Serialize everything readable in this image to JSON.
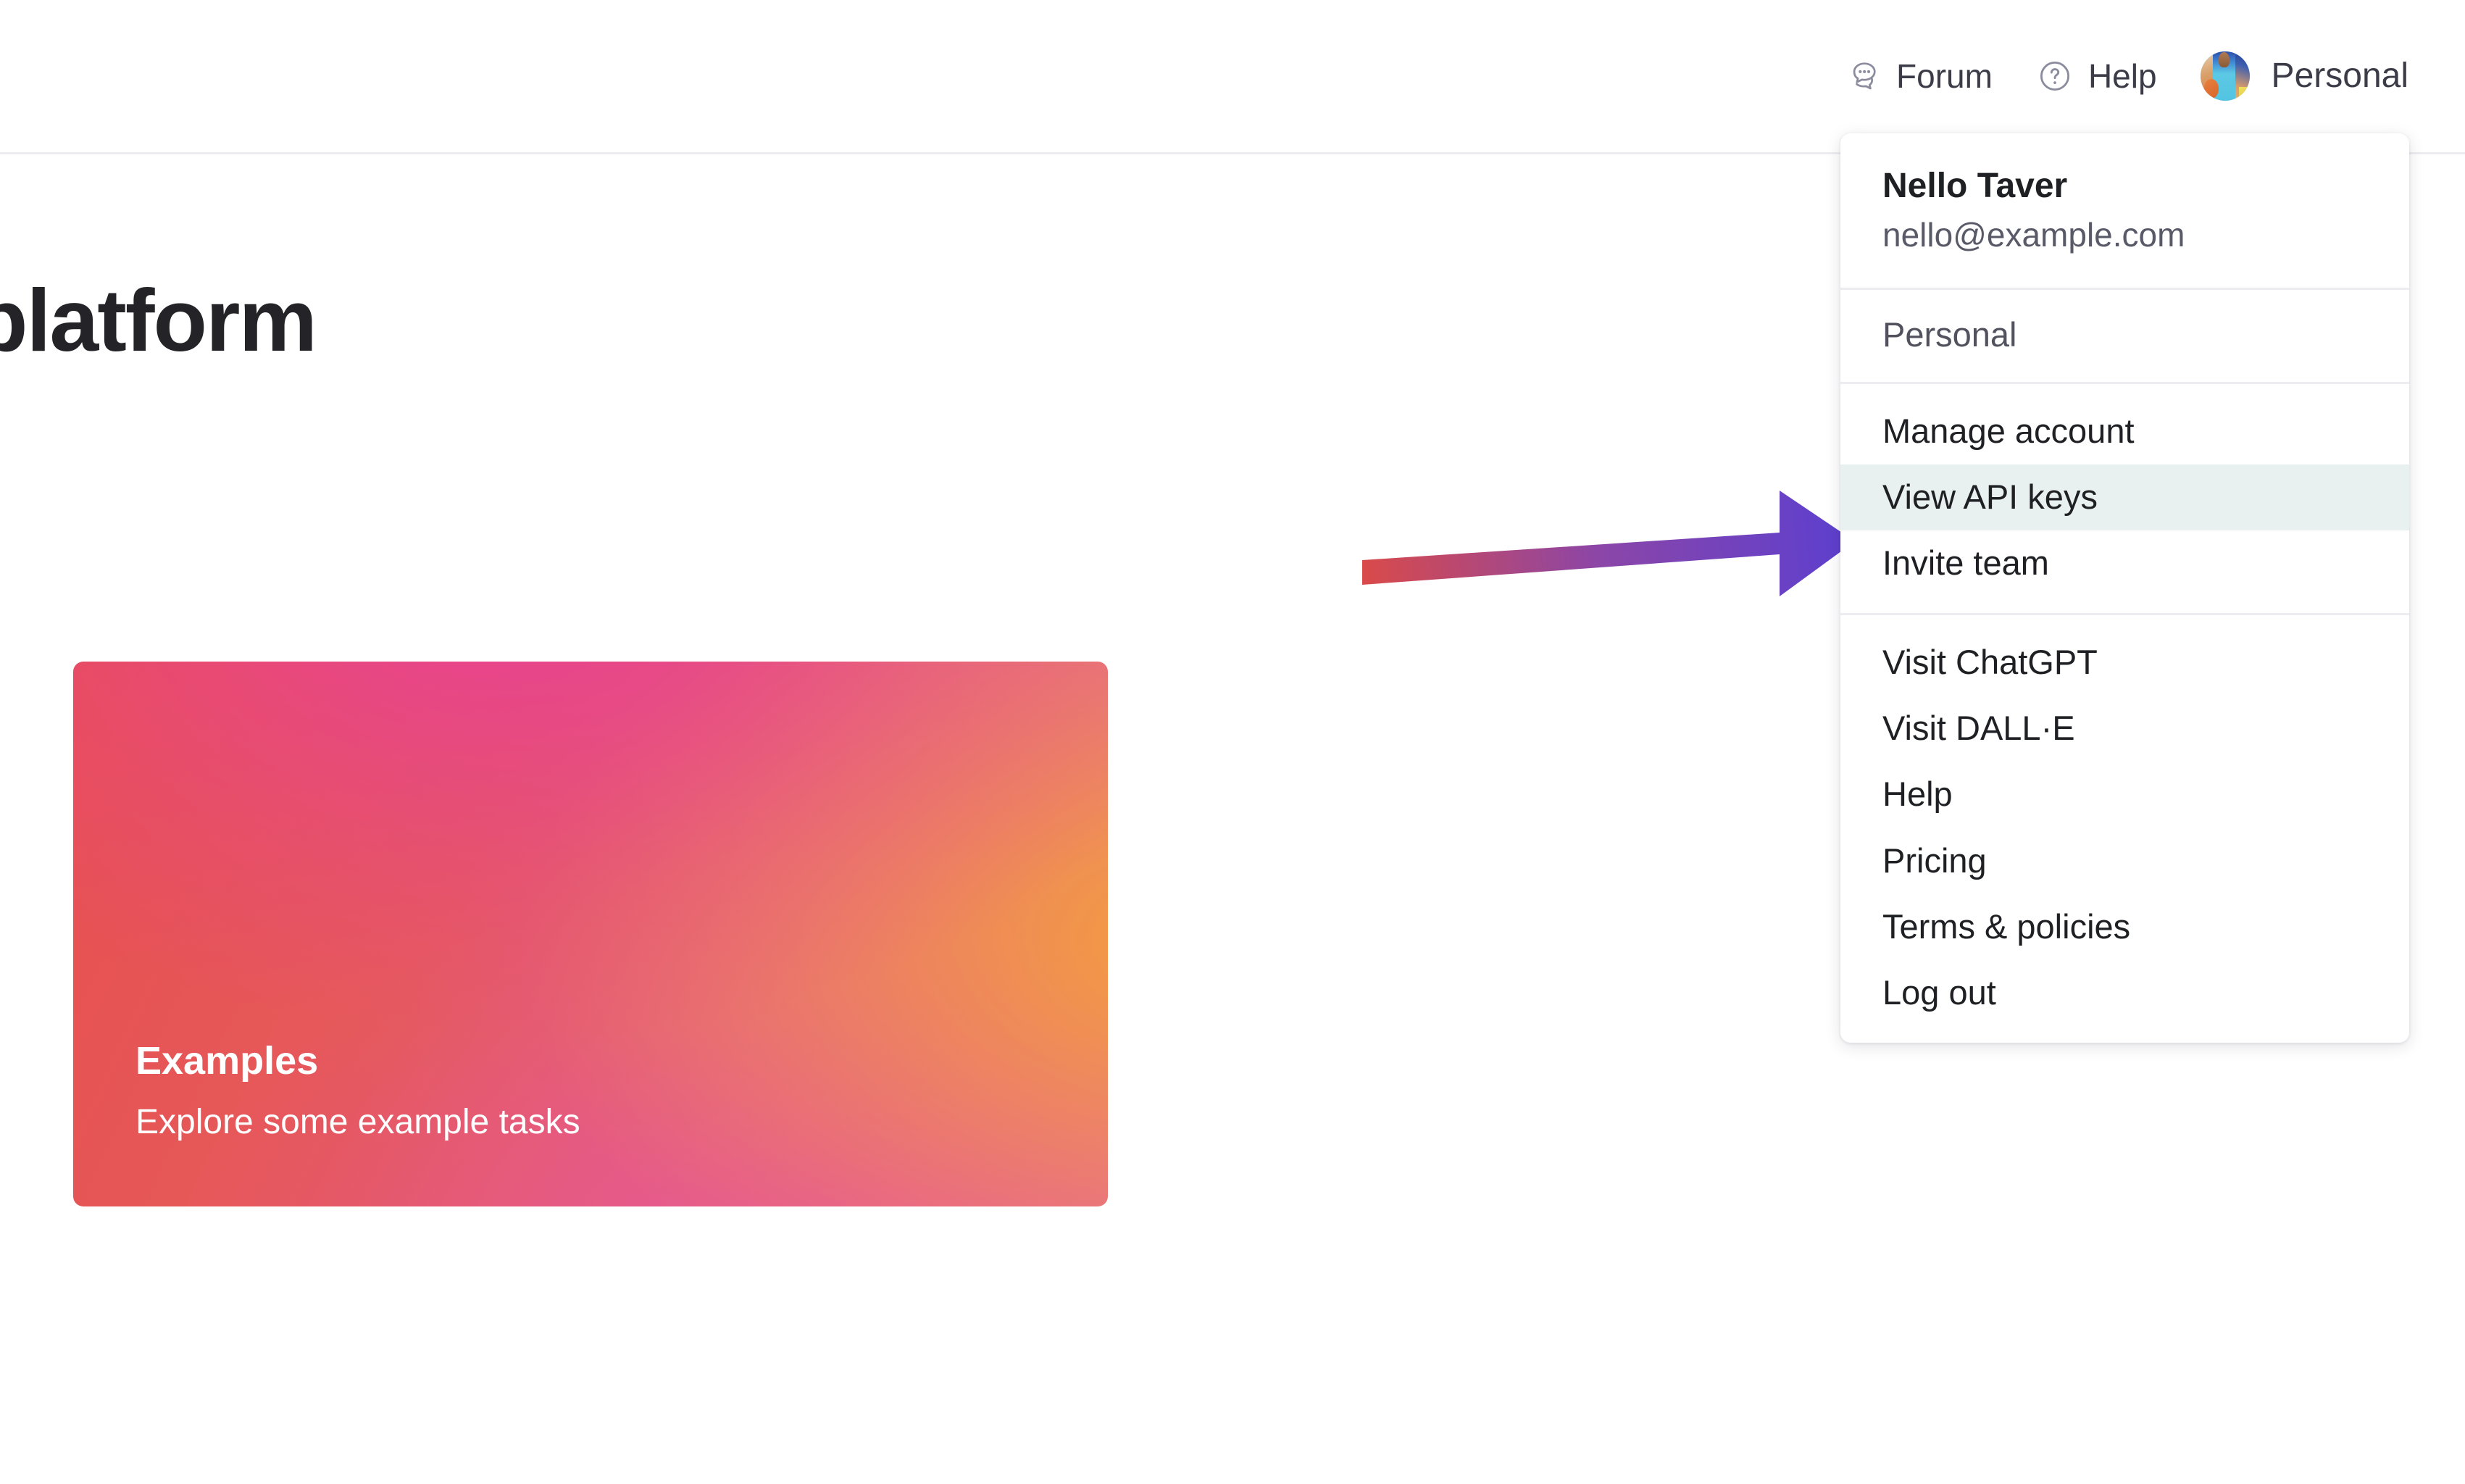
{
  "header": {
    "forum": {
      "label": "Forum",
      "icon": "chat-bubbles-icon"
    },
    "help": {
      "label": "Help",
      "icon": "question-circle-icon"
    },
    "account": {
      "label": "Personal",
      "icon": "avatar-image"
    }
  },
  "page": {
    "title": "platform",
    "card": {
      "title": "Examples",
      "subtitle": "Explore some example tasks",
      "gradient_from": "#E8504E",
      "gradient_mid": "#E84098",
      "gradient_to": "#F5A037"
    }
  },
  "annotation": {
    "type": "arrow",
    "points_to": "View API keys",
    "color_start": "#D94A4A",
    "color_end": "#5B3FD0"
  },
  "dropdown": {
    "user": {
      "name": "Nello Taver",
      "email": "nello@example.com"
    },
    "org_label": "Personal",
    "highlight_color": "#E8F0F0",
    "groups": [
      {
        "items": [
          {
            "label": "Manage account",
            "highlighted": false
          },
          {
            "label": "View API keys",
            "highlighted": true
          },
          {
            "label": "Invite team",
            "highlighted": false
          }
        ]
      },
      {
        "items": [
          {
            "label": "Visit ChatGPT",
            "highlighted": false
          },
          {
            "label": "Visit DALL·E",
            "highlighted": false
          },
          {
            "label": "Help",
            "highlighted": false
          },
          {
            "label": "Pricing",
            "highlighted": false
          },
          {
            "label": "Terms & policies",
            "highlighted": false
          },
          {
            "label": "Log out",
            "highlighted": false
          }
        ]
      }
    ]
  }
}
